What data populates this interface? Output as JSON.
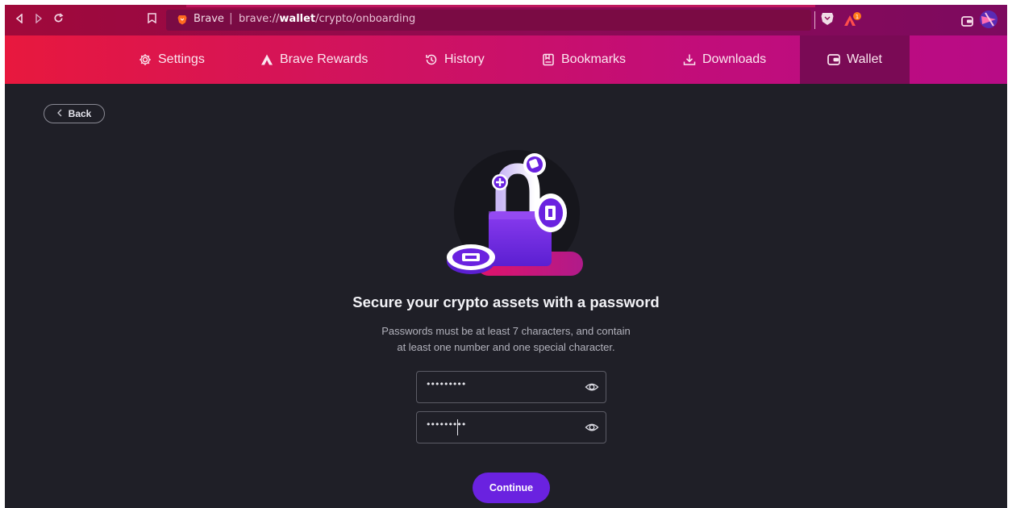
{
  "browser": {
    "brand": "Brave",
    "separator": "|",
    "url_prefix": "brave://",
    "url_host": "wallet",
    "url_path": "/crypto/onboarding",
    "accent": "#a0093a"
  },
  "nav_tabs": [
    {
      "label": "Settings",
      "icon": "gear-icon"
    },
    {
      "label": "Brave Rewards",
      "icon": "triangle-icon"
    },
    {
      "label": "History",
      "icon": "history-icon"
    },
    {
      "label": "Bookmarks",
      "icon": "bookmark-icon"
    },
    {
      "label": "Downloads",
      "icon": "download-icon"
    },
    {
      "label": "Wallet",
      "icon": "wallet-icon",
      "active": true
    }
  ],
  "page": {
    "back_label": "Back",
    "title": "Secure your crypto assets with a password",
    "description_line1": "Passwords must be at least 7 characters, and contain",
    "description_line2": "at least one number and one special character.",
    "password_value": "•••••••••",
    "confirm_value": "•••••••••",
    "continue_label": "Continue",
    "primary_color": "#6a22e0"
  }
}
